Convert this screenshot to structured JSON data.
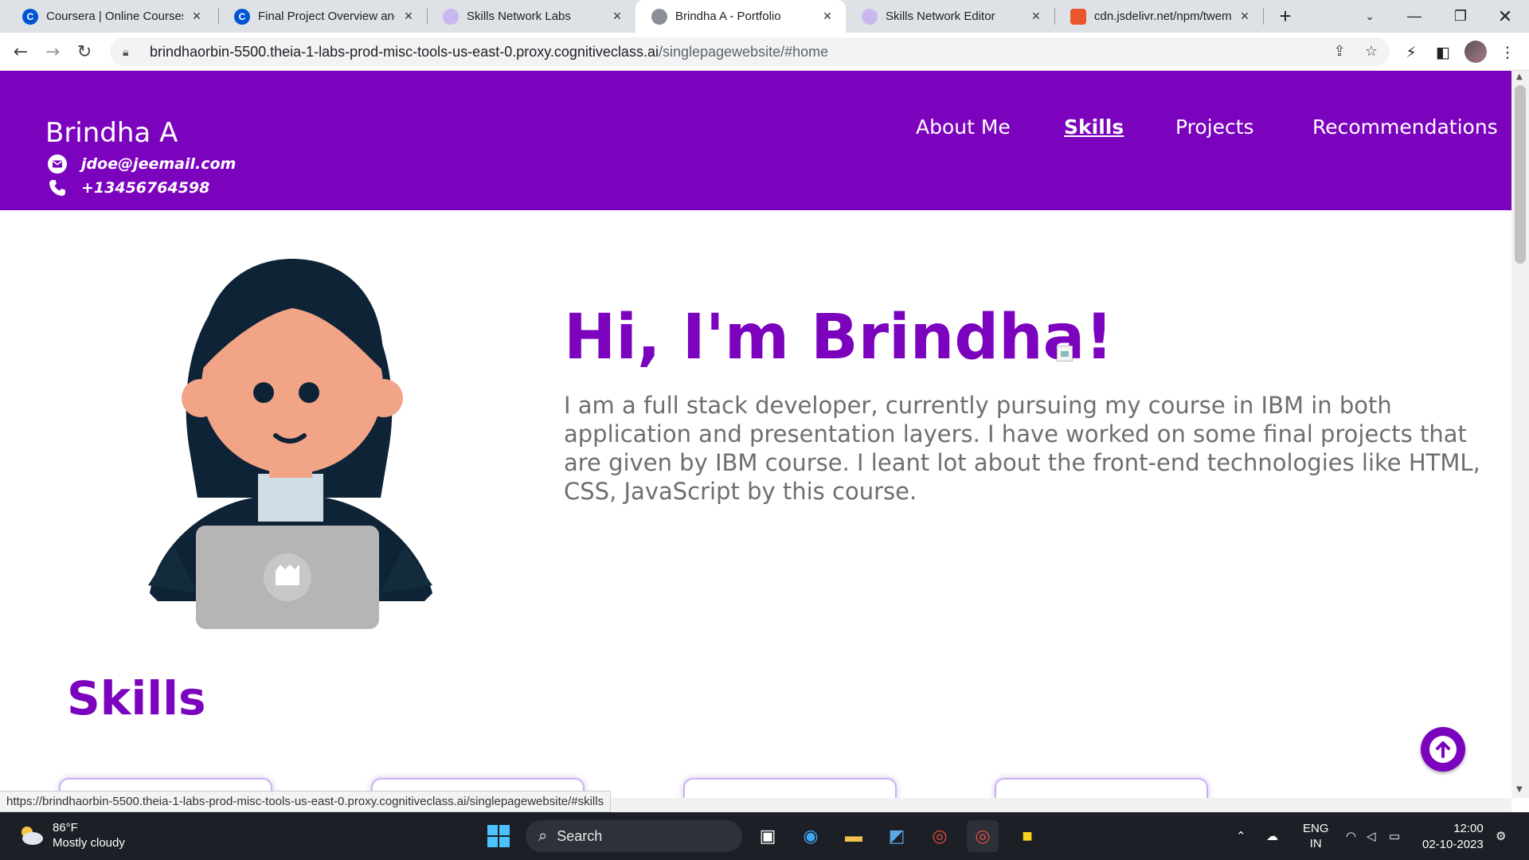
{
  "browser": {
    "tabs": [
      {
        "title": "Coursera | Online Courses",
        "icon": "coursera-icon",
        "active": false
      },
      {
        "title": "Final Project Overview and",
        "icon": "coursera-icon",
        "active": false
      },
      {
        "title": "Skills Network Labs",
        "icon": "skills-network-icon",
        "active": false
      },
      {
        "title": "Brindha A - Portfolio",
        "icon": "globe-icon",
        "active": true
      },
      {
        "title": "Skills Network Editor",
        "icon": "skills-network-icon",
        "active": false
      },
      {
        "title": "cdn.jsdelivr.net/npm/twem",
        "icon": "shield-icon",
        "active": false
      }
    ],
    "url_host": "brindhaorbin-5500.theia-1-labs-prod-misc-tools-us-east-0.proxy.cognitiveclass.ai",
    "url_path": "/singlepagewebsite/#home",
    "status_url": "https://brindhaorbin-5500.theia-1-labs-prod-misc-tools-us-east-0.proxy.cognitiveclass.ai/singlepagewebsite/#skills"
  },
  "site": {
    "name": "Brindha A",
    "email": "jdoe@jeemail.com",
    "phone": "+13456764598",
    "nav": [
      "About Me",
      "Skills",
      "Projects",
      "Recommendations"
    ],
    "current_nav": "Skills",
    "hero_title": "Hi, I'm Brindha!",
    "hero_text": "I am a full stack developer, currently pursuing my course in IBM in both application and presentation layers. I have worked on some final projects that are given by IBM course. I leant lot about the front-end technologies like HTML, CSS, JavaScript by this course.",
    "skills_heading": "Skills",
    "accent_color": "#7c03be"
  },
  "taskbar": {
    "weather_temp": "86°F",
    "weather_desc": "Mostly cloudy",
    "search_label": "Search",
    "lang_1": "ENG",
    "lang_2": "IN",
    "time": "12:00",
    "date": "02-10-2023"
  }
}
